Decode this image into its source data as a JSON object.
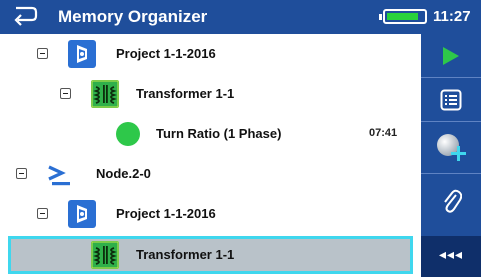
{
  "header": {
    "title": "Memory Organizer",
    "time": "11:27",
    "battery_level": 0.85
  },
  "tree": {
    "rows": [
      {
        "label": "Project 1-1-2016",
        "icon": "project-icon"
      },
      {
        "label": "Transformer 1-1",
        "icon": "transformer-icon"
      },
      {
        "label": "Turn Ratio (1 Phase)",
        "icon": "test-status-dot-icon",
        "time": "07:41"
      },
      {
        "label": "Node.2-0",
        "icon": "node-icon"
      },
      {
        "label": "Project 1-1-2016",
        "icon": "project-icon"
      },
      {
        "label": "Transformer 1-1",
        "icon": "transformer-icon",
        "selected": true
      }
    ]
  },
  "sidebar": {
    "buttons": [
      "play-icon",
      "list-icon",
      "add-measurement-icon",
      "attachment-icon"
    ],
    "more_label": "◂◂◂"
  },
  "colors": {
    "header_blue": "#1f4e9b",
    "selection_border": "#3fd7ee",
    "status_green": "#2ec84a",
    "transformer_green": "#2fb04a"
  }
}
